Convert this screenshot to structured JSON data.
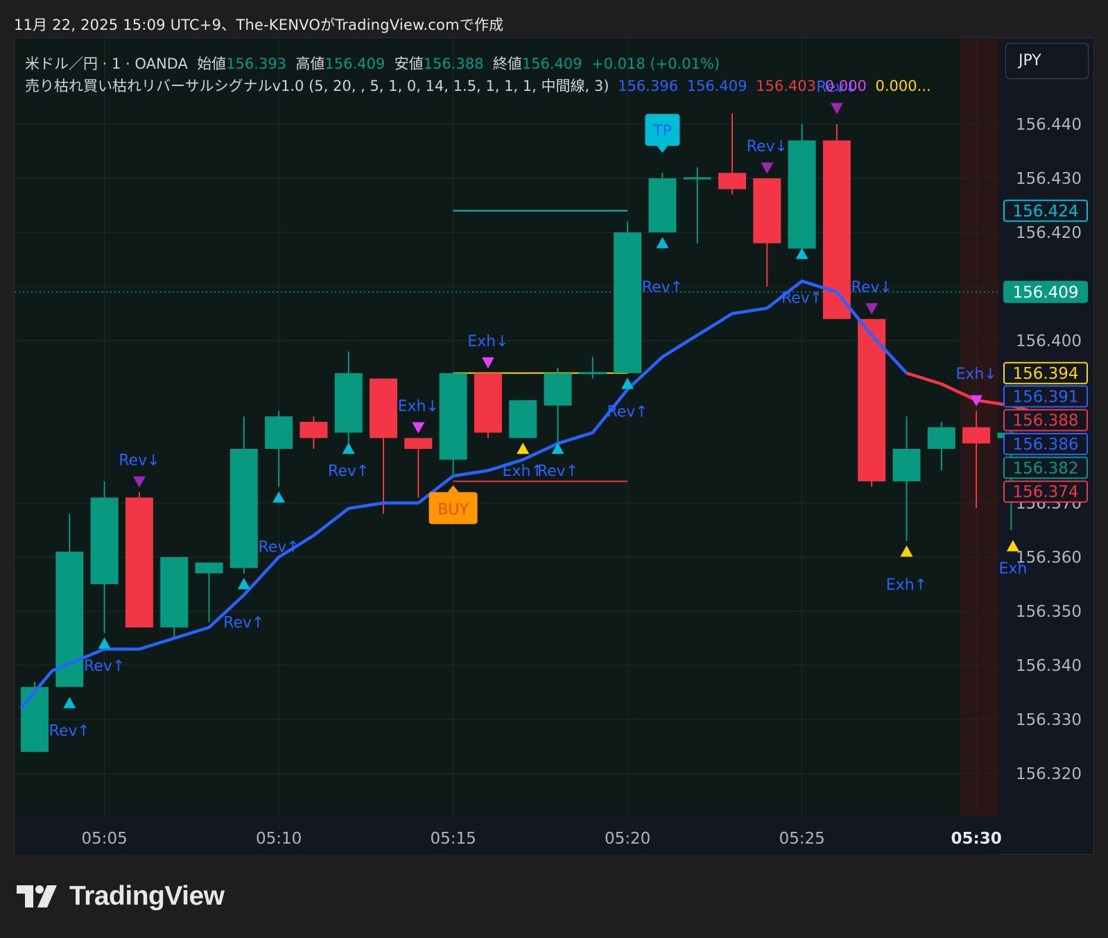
{
  "header": {
    "caption": "11月 22, 2025 15:09 UTC+9、The-KENVOがTradingView.comで作成"
  },
  "legend": {
    "symbol": "米ドル／円 · 1 · OANDA",
    "open_label": "始値",
    "open": "156.393",
    "high_label": "高値",
    "high": "156.409",
    "low_label": "安値",
    "low": "156.388",
    "close_label": "終値",
    "close": "156.409",
    "change": "+0.018 (+0.01%)",
    "indicator": "売り枯れ買い枯れリバーサルシグナルv1.0 (5, 20, , 5, 1, 0, 14, 1.5, 1, 1, 1, 中間線, 3)",
    "indicator_values": [
      {
        "text": "156.396",
        "color": "#2962ff"
      },
      {
        "text": "156.409",
        "color": "#2962ff"
      },
      {
        "text": "156.403",
        "color": "#f23645"
      },
      {
        "text": "0.000",
        "color": "#e040fb"
      },
      {
        "text": "0.000...",
        "color": "#ffd600"
      }
    ]
  },
  "currency": "JPY",
  "colors": {
    "up": "#089981",
    "down": "#f23645",
    "ma": "#2962ff",
    "ma_down": "#f23645",
    "rev_up": "#00bcd4",
    "rev_down": "#9c27b0",
    "exh_up": "#ffd600",
    "exh_down": "#e040fb",
    "label_text": "#2962ff",
    "buy": "#ff9800",
    "tp": "#00bcd4"
  },
  "chart_data": {
    "type": "candlestick",
    "symbol": "USDJPY 1m OANDA",
    "y_range": [
      156.312,
      156.453
    ],
    "y_ticks": [
      156.32,
      156.33,
      156.34,
      156.35,
      156.36,
      156.37,
      156.4,
      156.42,
      156.43,
      156.44
    ],
    "x_tick_labels": [
      {
        "t": "05:05",
        "i": 2
      },
      {
        "t": "05:10",
        "i": 7
      },
      {
        "t": "05:15",
        "i": 12
      },
      {
        "t": "05:20",
        "i": 17
      },
      {
        "t": "05:25",
        "i": 22
      },
      {
        "t": "05:30",
        "i": 27,
        "bold": true
      }
    ],
    "candles": [
      {
        "i": 0,
        "o": 156.324,
        "h": 156.337,
        "l": 156.324,
        "c": 156.336
      },
      {
        "i": 1,
        "o": 156.336,
        "h": 156.368,
        "l": 156.336,
        "c": 156.361
      },
      {
        "i": 2,
        "o": 156.355,
        "h": 156.374,
        "l": 156.346,
        "c": 156.371
      },
      {
        "i": 3,
        "o": 156.371,
        "h": 156.372,
        "l": 156.347,
        "c": 156.347
      },
      {
        "i": 4,
        "o": 156.347,
        "h": 156.36,
        "l": 156.345,
        "c": 156.36
      },
      {
        "i": 5,
        "o": 156.357,
        "h": 156.359,
        "l": 156.348,
        "c": 156.359
      },
      {
        "i": 6,
        "o": 156.358,
        "h": 156.386,
        "l": 156.357,
        "c": 156.38
      },
      {
        "i": 7,
        "o": 156.38,
        "h": 156.387,
        "l": 156.373,
        "c": 156.386
      },
      {
        "i": 8,
        "o": 156.385,
        "h": 156.386,
        "l": 156.38,
        "c": 156.382
      },
      {
        "i": 9,
        "o": 156.383,
        "h": 156.398,
        "l": 156.381,
        "c": 156.394
      },
      {
        "i": 10,
        "o": 156.393,
        "h": 156.393,
        "l": 156.368,
        "c": 156.382
      },
      {
        "i": 11,
        "o": 156.382,
        "h": 156.382,
        "l": 156.371,
        "c": 156.38
      },
      {
        "i": 12,
        "o": 156.378,
        "h": 156.394,
        "l": 156.375,
        "c": 156.394
      },
      {
        "i": 13,
        "o": 156.394,
        "h": 156.394,
        "l": 156.382,
        "c": 156.383
      },
      {
        "i": 14,
        "o": 156.382,
        "h": 156.389,
        "l": 156.382,
        "c": 156.389
      },
      {
        "i": 15,
        "o": 156.388,
        "h": 156.395,
        "l": 156.38,
        "c": 156.394
      },
      {
        "i": 16,
        "o": 156.394,
        "h": 156.397,
        "l": 156.393,
        "c": 156.394
      },
      {
        "i": 17,
        "o": 156.394,
        "h": 156.422,
        "l": 156.394,
        "c": 156.42
      },
      {
        "i": 18,
        "o": 156.42,
        "h": 156.431,
        "l": 156.42,
        "c": 156.43
      },
      {
        "i": 19,
        "o": 156.43,
        "h": 156.432,
        "l": 156.418,
        "c": 156.43
      },
      {
        "i": 20,
        "o": 156.431,
        "h": 156.442,
        "l": 156.427,
        "c": 156.428
      },
      {
        "i": 21,
        "o": 156.43,
        "h": 156.43,
        "l": 156.41,
        "c": 156.418
      },
      {
        "i": 22,
        "o": 156.417,
        "h": 156.44,
        "l": 156.417,
        "c": 156.437
      },
      {
        "i": 23,
        "o": 156.437,
        "h": 156.44,
        "l": 156.404,
        "c": 156.404
      },
      {
        "i": 24,
        "o": 156.404,
        "h": 156.404,
        "l": 156.373,
        "c": 156.374
      },
      {
        "i": 25,
        "o": 156.374,
        "h": 156.386,
        "l": 156.363,
        "c": 156.38
      },
      {
        "i": 26,
        "o": 156.38,
        "h": 156.385,
        "l": 156.376,
        "c": 156.384
      },
      {
        "i": 27,
        "o": 156.384,
        "h": 156.387,
        "l": 156.369,
        "c": 156.381
      },
      {
        "i": 28,
        "o": 156.382,
        "h": 156.386,
        "l": 156.365,
        "c": 156.383
      }
    ],
    "ma_line": [
      [
        -0.4,
        156.332
      ],
      [
        0.5,
        156.339
      ],
      [
        2,
        156.343
      ],
      [
        3,
        156.343
      ],
      [
        4,
        156.345
      ],
      [
        5,
        156.347
      ],
      [
        6,
        156.353
      ],
      [
        7,
        156.36
      ],
      [
        8,
        156.364
      ],
      [
        9,
        156.369
      ],
      [
        10,
        156.37
      ],
      [
        11,
        156.37
      ],
      [
        12,
        156.375
      ],
      [
        13,
        156.376
      ],
      [
        14,
        156.378
      ],
      [
        15,
        156.381
      ],
      [
        16,
        156.383
      ],
      [
        17,
        156.391
      ],
      [
        18,
        156.397
      ],
      [
        19,
        156.401
      ],
      [
        20,
        156.405
      ],
      [
        21,
        156.406
      ],
      [
        22,
        156.411
      ],
      [
        23,
        156.409
      ],
      [
        24,
        156.401
      ],
      [
        25,
        156.394
      ]
    ],
    "ma_line_down": [
      [
        25,
        156.394
      ],
      [
        26,
        156.392
      ],
      [
        27,
        156.389
      ],
      [
        28,
        156.388
      ],
      [
        28.55,
        156.387
      ]
    ],
    "level_lines": [
      {
        "color": "#00bcd4",
        "y": 156.424,
        "x0": 12,
        "x1": 17
      },
      {
        "color": "#ffd600",
        "y": 156.394,
        "x0": 12,
        "x1": 17
      },
      {
        "color": "#f23645",
        "y": 156.374,
        "x0": 12,
        "x1": 17
      }
    ],
    "last_price_line": {
      "y": 156.409,
      "color": "#089981"
    },
    "markers": [
      {
        "i": 1,
        "type": "up",
        "color": "#00bcd4",
        "y": 156.333,
        "label": "Rev↑",
        "ly": 156.328
      },
      {
        "i": 2,
        "type": "up",
        "color": "#00bcd4",
        "y": 156.344,
        "label": "Rev↑",
        "ly": 156.34
      },
      {
        "i": 3,
        "type": "down",
        "color": "#9c27b0",
        "y": 156.374,
        "label": "Rev↓",
        "ly": 156.378
      },
      {
        "i": 6,
        "type": "up",
        "color": "#00bcd4",
        "y": 156.355,
        "label": "Rev↑",
        "ly": 156.348
      },
      {
        "i": 7,
        "type": "up",
        "color": "#00bcd4",
        "y": 156.371,
        "label": "Rev↑",
        "ly": 156.362
      },
      {
        "i": 9,
        "type": "up",
        "color": "#00bcd4",
        "y": 156.38,
        "label": "Rev↑",
        "ly": 156.376
      },
      {
        "i": 11,
        "type": "down",
        "color": "#e040fb",
        "y": 156.384,
        "label": "Exh↓",
        "ly": 156.388
      },
      {
        "i": 13,
        "type": "down",
        "color": "#e040fb",
        "y": 156.396,
        "label": "Exh↓",
        "ly": 156.4
      },
      {
        "i": 14,
        "type": "up",
        "color": "#ffd600",
        "y": 156.38,
        "label": "Exh↑",
        "ly": 156.376
      },
      {
        "i": 15,
        "type": "up",
        "color": "#00bcd4",
        "y": 156.38,
        "label": "Rev↑",
        "ly": 156.376
      },
      {
        "i": 17,
        "type": "up",
        "color": "#00bcd4",
        "y": 156.392,
        "label": "Rev↑",
        "ly": 156.387
      },
      {
        "i": 18,
        "type": "up",
        "color": "#00bcd4",
        "y": 156.418,
        "label": "Rev↑",
        "ly": 156.41
      },
      {
        "i": 21,
        "type": "down",
        "color": "#9c27b0",
        "y": 156.432,
        "label": "Rev↓",
        "ly": 156.436
      },
      {
        "i": 22,
        "type": "up",
        "color": "#00bcd4",
        "y": 156.416,
        "label": "Rev↑",
        "ly": 156.408
      },
      {
        "i": 23,
        "type": "down",
        "color": "#9c27b0",
        "y": 156.443,
        "label": "Rev↓",
        "ly": 156.447
      },
      {
        "i": 24,
        "type": "down",
        "color": "#9c27b0",
        "y": 156.406,
        "label": "Rev↓",
        "ly": 156.41
      },
      {
        "i": 25,
        "type": "up",
        "color": "#ffd600",
        "y": 156.361,
        "label": "Exh↑",
        "ly": 156.355
      },
      {
        "i": 27,
        "type": "down",
        "color": "#e040fb",
        "y": 156.389,
        "label": "Exh↓",
        "ly": 156.394
      },
      {
        "i": 28.05,
        "type": "up",
        "color": "#ffd600",
        "y": 156.362,
        "label": "Exh",
        "ly": 156.358
      }
    ],
    "tags": [
      {
        "text": "BUY",
        "i": 12,
        "y": 156.372,
        "bg": "#ff9800",
        "fg": "#e65100",
        "dir": "up"
      },
      {
        "text": "TP",
        "i": 18,
        "y": 156.436,
        "bg": "#00bcd4",
        "fg": "#2962ff",
        "dir": "down"
      }
    ],
    "price_badges": [
      {
        "text": "156.424",
        "y": 156.424,
        "border": "#00bcd4",
        "fg": "#00bcd4",
        "fill": false
      },
      {
        "text": "156.409",
        "y": 156.409,
        "border": "#089981",
        "fg": "#ffffff",
        "fill": true
      },
      {
        "text": "156.394",
        "y": 156.394,
        "border": "#ffd600",
        "fg": "#ffd600",
        "fill": false
      },
      {
        "text": "156.391",
        "y": 156.3897,
        "border": "#2962ff",
        "fg": "#2962ff",
        "fill": false
      },
      {
        "text": "156.388",
        "y": 156.3853,
        "border": "#f23645",
        "fg": "#f23645",
        "fill": false
      },
      {
        "text": "156.386",
        "y": 156.3809,
        "border": "#2962ff",
        "fg": "#2962ff",
        "fill": false
      },
      {
        "text": "156.382",
        "y": 156.3765,
        "border": "#089981",
        "fg": "#089981",
        "fill": false
      },
      {
        "text": "156.374",
        "y": 156.3721,
        "border": "#f23645",
        "fg": "#f23645",
        "fill": false
      }
    ],
    "session_shade": {
      "from_i": 26.54,
      "color": "#2a1517"
    },
    "grid": true
  },
  "footer": {
    "brand": "TradingView"
  }
}
